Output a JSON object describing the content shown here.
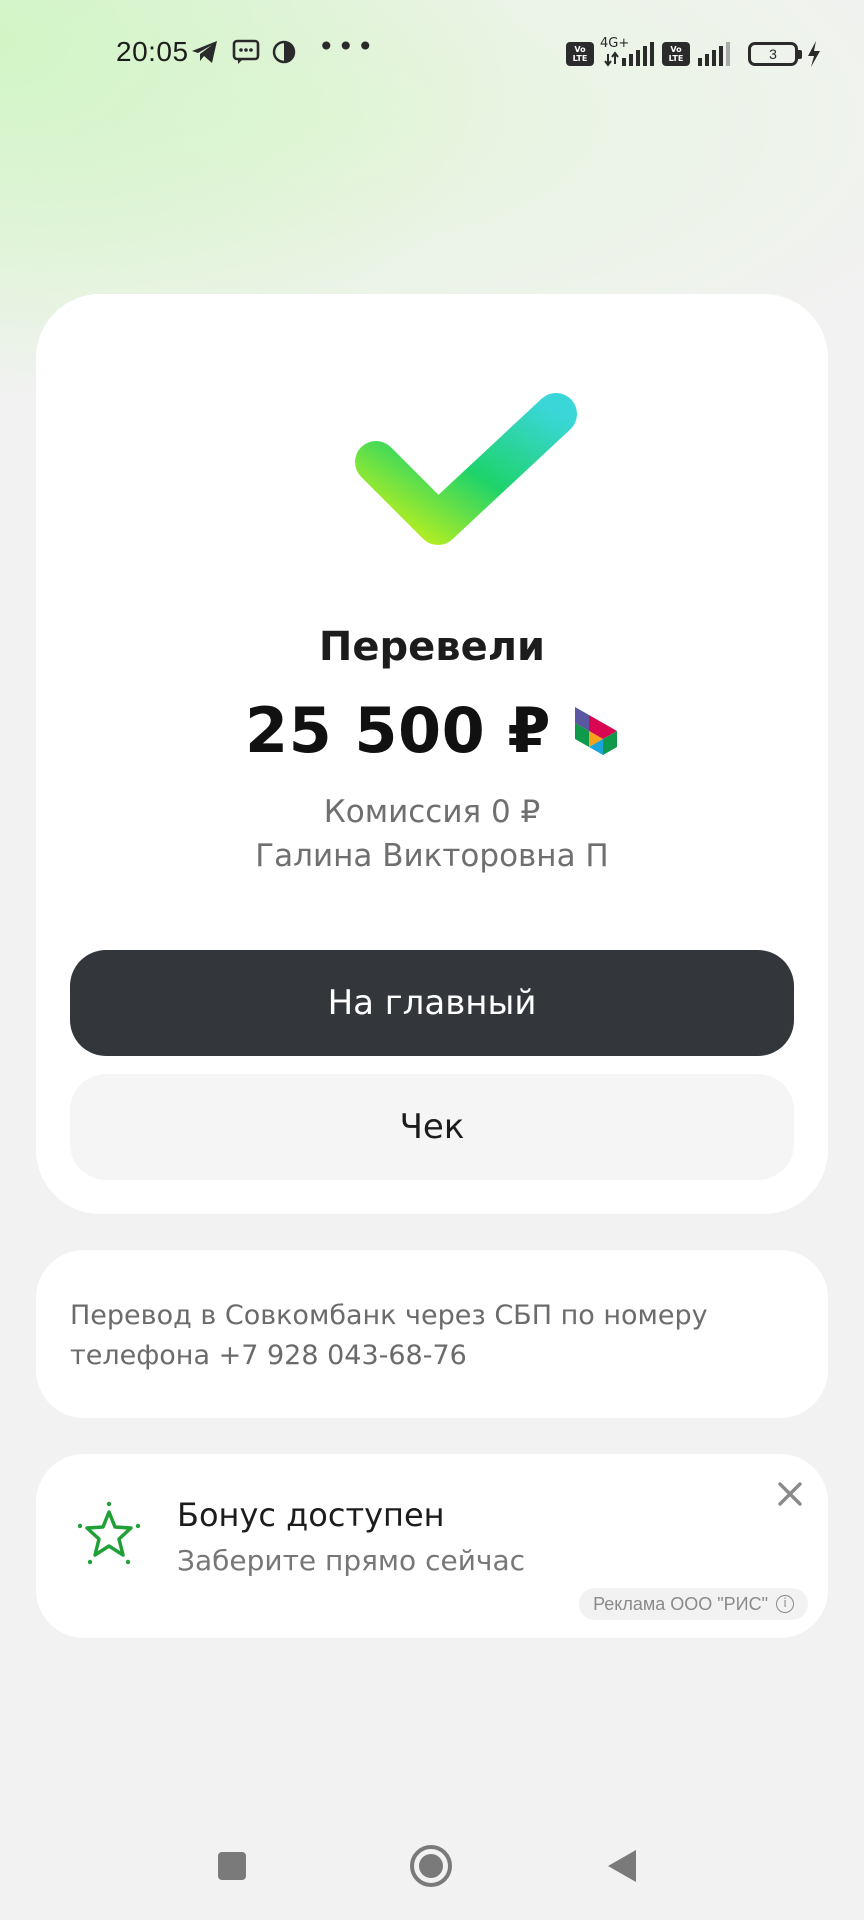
{
  "status_bar": {
    "time": "20:05",
    "network_label": "4G+",
    "volte_label": "Vo LTE",
    "battery_level": "3",
    "icons": [
      "telegram-icon",
      "message-icon",
      "app-icon",
      "more-dots-icon",
      "volte-icon",
      "signal-icon",
      "battery-icon",
      "charging-icon"
    ],
    "dots": "•••"
  },
  "result": {
    "title": "Перевели",
    "amount": "25 500 ₽",
    "fee": "Комиссия 0 ₽",
    "recipient": "Галина Викторовна П",
    "colors": {
      "check_start": "#c6f11a",
      "check_mid": "#1ed36a",
      "check_end": "#3ad6d8"
    }
  },
  "buttons": {
    "home_label": "На главный",
    "receipt_label": "Чек"
  },
  "info": {
    "text": "Перевод в Совкомбанк через СБП по номеру телефона +7 928 043-68-76"
  },
  "ad": {
    "title": "Бонус доступен",
    "subtitle": "Заберите прямо сейчас",
    "label": "Реклама ООО \"РИС\"",
    "info_glyph": "i",
    "accent_color": "#21a038"
  }
}
